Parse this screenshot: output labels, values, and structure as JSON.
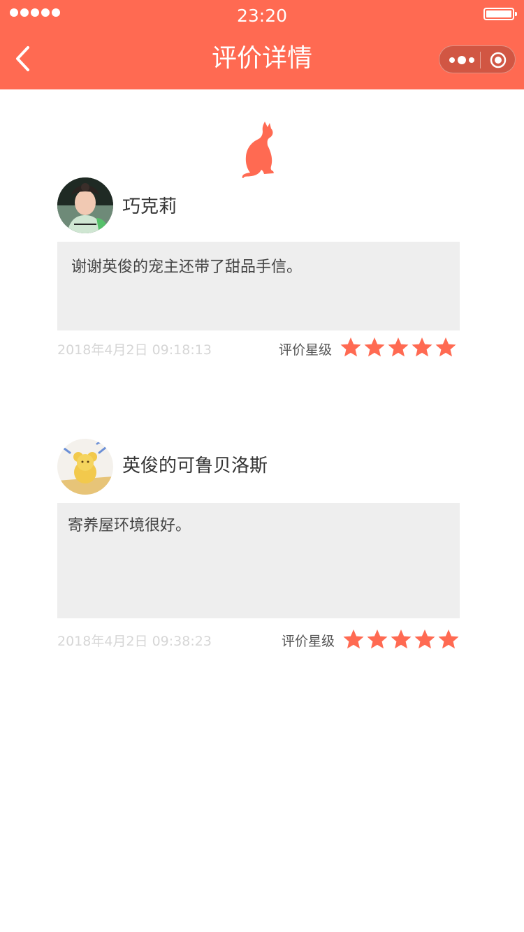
{
  "status_bar": {
    "time": "23:20"
  },
  "nav": {
    "title": "评价详情"
  },
  "colors": {
    "brand": "#ff6a52",
    "star": "#ff6a52",
    "comment_bg": "#eeeeee"
  },
  "logo_icon": "cat-icon",
  "reviews": [
    {
      "username": "巧克莉",
      "comment": "谢谢英俊的宠主还带了甜品手信。",
      "timestamp": "2018年4月2日  09:18:13",
      "rating_label": "评价星级",
      "rating": 5
    },
    {
      "username": "英俊的可鲁贝洛斯",
      "comment": "寄养屋环境很好。",
      "timestamp": "2018年4月2日  09:38:23",
      "rating_label": "评价星级",
      "rating": 5
    }
  ]
}
